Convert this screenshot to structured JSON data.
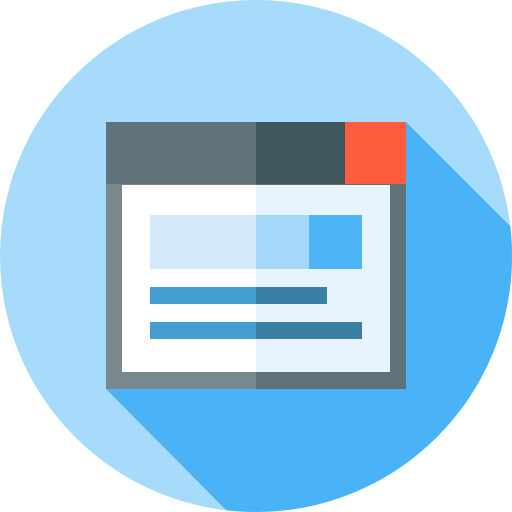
{
  "icon": {
    "name": "browser-window-icon",
    "style": "flat-long-shadow"
  },
  "colors": {
    "background_circle": "#a6dbfc",
    "long_shadow": "#4ab2f6",
    "titlebar_left": "#5e7278",
    "titlebar_right": "#3f5860",
    "close_button": "#ff5d3d",
    "frame_left": "#79888d",
    "frame_right": "#5f7278",
    "content_left": "#ffffff",
    "content_right": "#e8f4fd",
    "banner_left": "#d3eafc",
    "banner_mid": "#a6d8fb",
    "banner_right": "#4eb5f6",
    "line_left": "#449ed0",
    "line_right": "#3a7fa4"
  }
}
